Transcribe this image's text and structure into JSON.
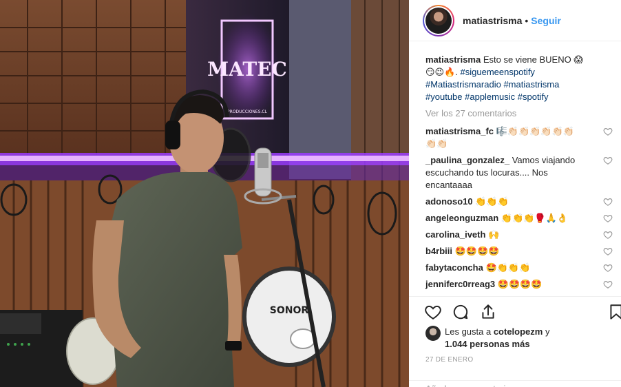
{
  "post": {
    "author": "matiastrisma",
    "follow_label": "Seguir",
    "separator": "•",
    "caption": {
      "username": "matiastrisma",
      "text": "Esto se viene BUENO 😱😏😉🔥.",
      "hashtags": [
        "#siguemeenspotify",
        "#Matiastrismaradio",
        "#matiastrisma",
        "#youtube",
        "#applemusic",
        "#spotify"
      ]
    },
    "view_all_comments": "Ver los 27 comentarios",
    "comments": [
      {
        "username": "matiastrisma_fc",
        "text": "🎼👏🏻👏🏻👏🏻👏🏻👏🏻👏🏻👏🏻👏🏻"
      },
      {
        "username": "_paulina_gonzalez_",
        "text": "Vamos viajando escuchando tus locuras.... Nos encantaaaa"
      },
      {
        "username": "adonoso10",
        "text": "👏👏👏"
      },
      {
        "username": "angeleonguzman",
        "text": "👏👏👏🥊🙏👌"
      },
      {
        "username": "carolina_iveth",
        "text": "🙌"
      },
      {
        "username": "b4rbiii",
        "text": "🤩🤩🤩🤩"
      },
      {
        "username": "fabytaconcha",
        "text": "🤩👏👏👏"
      },
      {
        "username": "jenniferc0rreag3",
        "text": "🤩🤩🤩🤩"
      }
    ],
    "likes": {
      "prefix": "Les gusta a ",
      "user": "cotelopezm",
      "connector": " y",
      "count": "1.044 personas más"
    },
    "date": "27 DE ENERO",
    "add_comment_placeholder": "Añade un comentario..."
  },
  "photo": {
    "studio_sign": "MATEC",
    "studio_sign_small": "PRODUCCIONES.CL",
    "drum_brand": "SONOR"
  },
  "colors": {
    "link_blue": "#3897f0",
    "hashtag_blue": "#003569",
    "muted": "#999999",
    "neon_purple": "#b04cff"
  },
  "icons": [
    "heart-icon",
    "comment-icon",
    "share-icon",
    "bookmark-icon"
  ]
}
